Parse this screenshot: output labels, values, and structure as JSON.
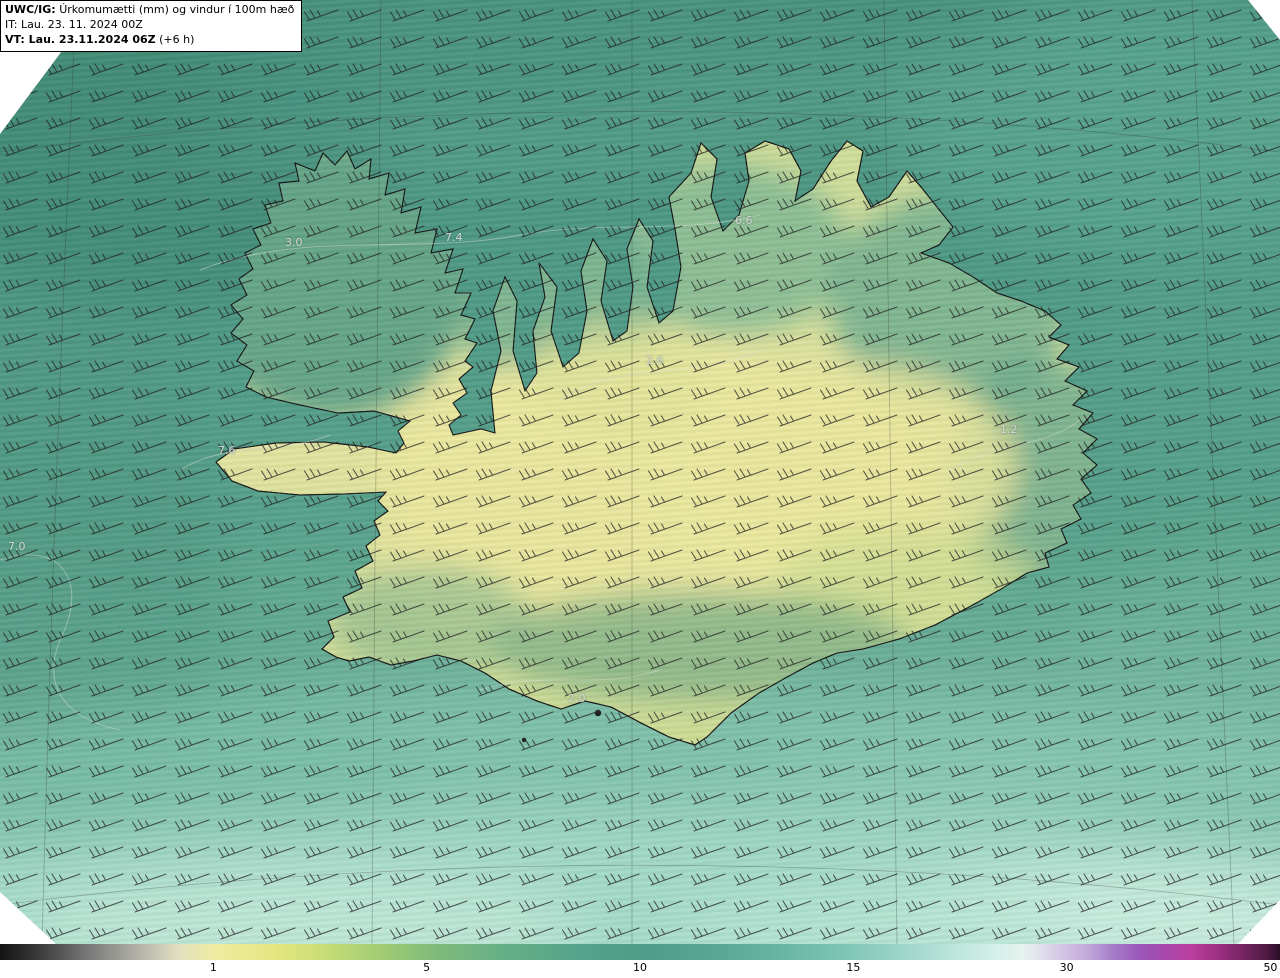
{
  "header": {
    "model": "UWC/IG:",
    "product": "Úrkomumætti (mm) og vindur í 100m hæð",
    "init_time": "IT: Lau. 23. 11. 2024 00Z",
    "valid_time": "VT: Lau. 23.11.2024 06Z",
    "valid_time_offset": "(+6 h)"
  },
  "map": {
    "region": "Iceland",
    "contour_labels": [
      {
        "text": "3.0"
      },
      {
        "text": "7.4"
      },
      {
        "text": "6.6"
      },
      {
        "text": "2.6"
      },
      {
        "text": "7.6"
      },
      {
        "text": "1.2"
      },
      {
        "text": "7.0"
      },
      {
        "text": "2.0"
      }
    ]
  },
  "colorbar": {
    "ticks": [
      "1",
      "5",
      "10",
      "15",
      "30",
      "50"
    ],
    "gradient_stops": [
      "#141414 0%",
      "#3a3a3a 3%",
      "#7a7a7a 7%",
      "#b5b5ab 11%",
      "#e2e0c0 14%",
      "#efec9e 17%",
      "#e2e67e 22%",
      "#c2da76 26%",
      "#9fcb74 30%",
      "#7fbb7a 34%",
      "#68b086 39%",
      "#55a38a 45%",
      "#4f9c88 50%",
      "#58a794 56%",
      "#68b5a3 61%",
      "#7fc5b5 66%",
      "#99d3c7 70%",
      "#b8e3d9 74%",
      "#d5f0e9 78%",
      "#e7f3ef 80%",
      "#dcd4ea 82%",
      "#c1a8da 85%",
      "#a67cc8 87%",
      "#9a58b9 89%",
      "#a849ac 91%",
      "#bb3f9f 93%",
      "#9e3183 95%",
      "#782564 97%",
      "#4f1a44 99%",
      "#2a0e25 100%"
    ]
  },
  "colors": {
    "sea_mid": "#4f9c88",
    "land_dry": "#e9e69e",
    "coastline": "#161616",
    "wind_barb": "#1c1c1c"
  }
}
